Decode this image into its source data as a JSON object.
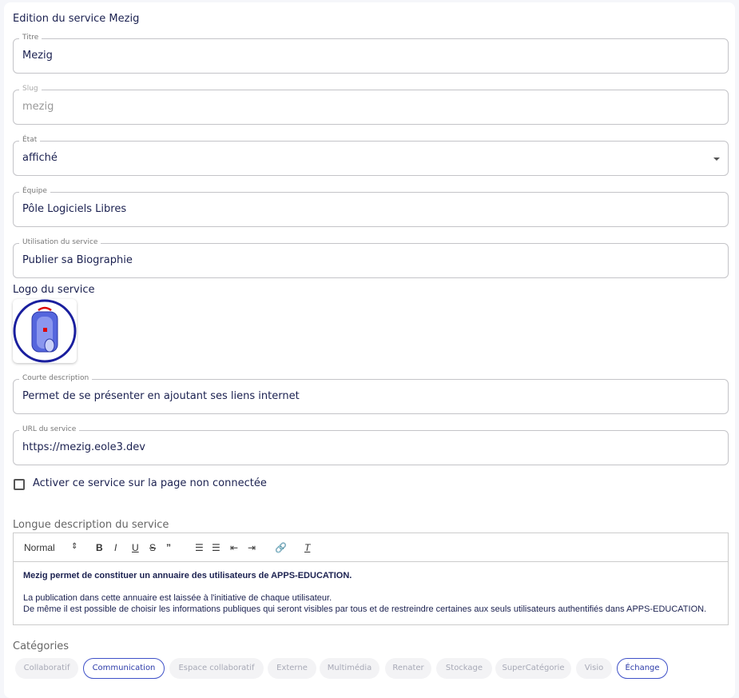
{
  "title": "Edition du service Mezig",
  "fields": {
    "titre": {
      "label": "Titre",
      "value": "Mezig"
    },
    "slug": {
      "label": "Slug",
      "value": "mezig"
    },
    "etat": {
      "label": "État",
      "value": "affiché"
    },
    "equipe": {
      "label": "Équipe",
      "value": "Pôle Logiciels Libres"
    },
    "usage": {
      "label": "Utilisation du service",
      "value": "Publier sa Biographie"
    },
    "short": {
      "label": "Courte description",
      "value": "Permet de se présenter en ajoutant ses liens internet"
    },
    "url": {
      "label": "URL du service",
      "value": "https://mezig.eole3.dev"
    }
  },
  "logo_label": "Logo du service",
  "checkbox": {
    "label": "Activer ce service sur la page non connectée",
    "checked": false
  },
  "long_label": "Longue description du service",
  "editor": {
    "format": "Normal",
    "bold_line": "Mezig permet de constituer un annuaire des utilisateurs de APPS-EDUCATION.",
    "line2": "La publication dans cette annuaire est laissée à l'initiative de chaque utilisateur.",
    "line3": "De même il est possible de choisir les informations publiques qui seront visibles par tous et de restreindre certaines aux seuls utilisateurs authentifiés dans APPS-EDUCATION."
  },
  "categories_label": "Catégories",
  "categories": [
    {
      "label": "Collaboratif",
      "selected": false
    },
    {
      "label": "Communication",
      "selected": true
    },
    {
      "label": "Espace collaboratif",
      "selected": false
    },
    {
      "label": "Externe",
      "selected": false
    },
    {
      "label": "Multimédia",
      "selected": false
    },
    {
      "label": "Renater",
      "selected": false
    },
    {
      "label": "Stockage",
      "selected": false
    },
    {
      "label": "SuperCatégorie",
      "selected": false
    },
    {
      "label": "Visio",
      "selected": false
    },
    {
      "label": "Échange",
      "selected": true
    }
  ],
  "colors": {
    "accent": "#3f51c8",
    "text": "#1b2150"
  }
}
